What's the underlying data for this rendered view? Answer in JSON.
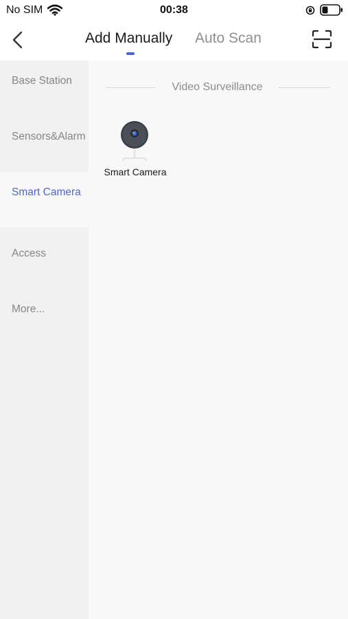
{
  "status_bar": {
    "carrier": "No SIM",
    "time": "00:38"
  },
  "nav": {
    "tabs": [
      {
        "label": "Add Manually",
        "active": true
      },
      {
        "label": "Auto Scan",
        "active": false
      }
    ],
    "accent_color": "#4a63d6"
  },
  "sidebar": {
    "items": [
      {
        "label": "Base Station",
        "active": false
      },
      {
        "label": "Sensors&Alarm",
        "active": false
      },
      {
        "label": "Smart Camera",
        "active": true
      },
      {
        "label": "Access",
        "active": false
      },
      {
        "label": "More...",
        "active": false
      }
    ]
  },
  "content": {
    "section_title": "Video Surveillance",
    "devices": [
      {
        "label": "Smart Camera",
        "icon": "smart-camera-icon"
      }
    ]
  }
}
